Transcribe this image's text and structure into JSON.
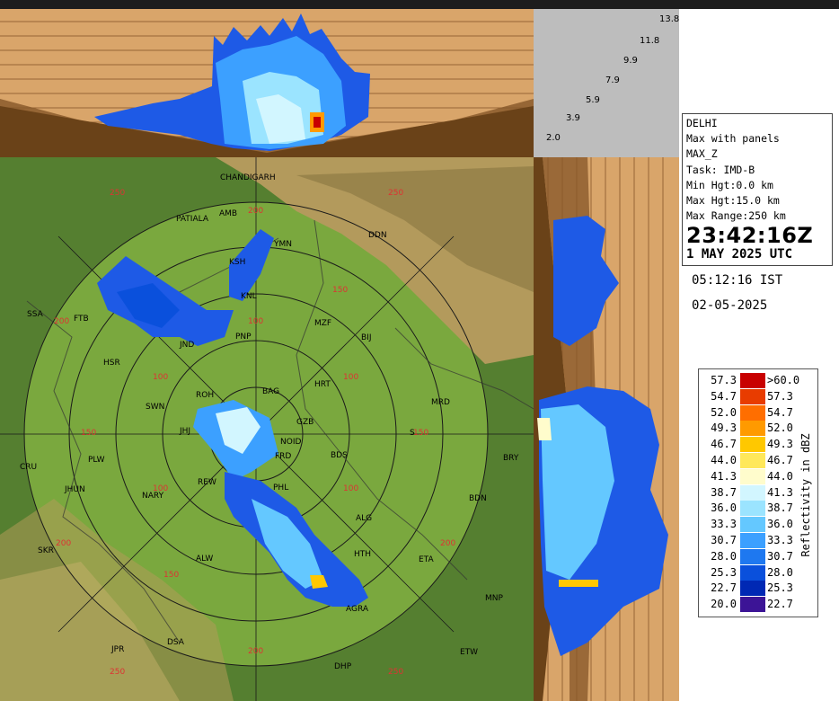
{
  "info": {
    "station": "DELHI",
    "product": "Max with panels",
    "field": "MAX_Z",
    "task": "Task: IMD-B",
    "min_hgt": "Min Hgt:0.0 km",
    "max_hgt": "Max Hgt:15.0 km",
    "max_range": "Max Range:250 km",
    "time_utc": "23:42:16Z",
    "date_utc": "1 MAY 2025 UTC",
    "time_ist": "05:12:16 IST",
    "date_local": "02-05-2025"
  },
  "height_scale": [
    "13.8",
    "11.8",
    "9.9",
    "7.9",
    "5.9",
    "3.9",
    "2.0"
  ],
  "legend": {
    "title": "Reflectivity in dBZ",
    "rows": [
      {
        "low": "57.3",
        "high": ">60.0",
        "color": "#c80000"
      },
      {
        "low": "54.7",
        "high": "57.3",
        "color": "#e83c00"
      },
      {
        "low": "52.0",
        "high": "54.7",
        "color": "#ff6e00"
      },
      {
        "low": "49.3",
        "high": "52.0",
        "color": "#ff9a00"
      },
      {
        "low": "46.7",
        "high": "49.3",
        "color": "#ffc800"
      },
      {
        "low": "44.0",
        "high": "46.7",
        "color": "#ffe85a"
      },
      {
        "low": "41.3",
        "high": "44.0",
        "color": "#fffccc"
      },
      {
        "low": "38.7",
        "high": "41.3",
        "color": "#d2f6ff"
      },
      {
        "low": "36.0",
        "high": "38.7",
        "color": "#9be4ff"
      },
      {
        "low": "33.3",
        "high": "36.0",
        "color": "#64c8ff"
      },
      {
        "low": "30.7",
        "high": "33.3",
        "color": "#3ca0ff"
      },
      {
        "low": "28.0",
        "high": "30.7",
        "color": "#1e78f0"
      },
      {
        "low": "25.3",
        "high": "28.0",
        "color": "#0a50dc"
      },
      {
        "low": "22.7",
        "high": "25.3",
        "color": "#0028b4"
      },
      {
        "low": "20.0",
        "high": "22.7",
        "color": "#3c1496"
      }
    ]
  },
  "range_rings": [
    "50",
    "100",
    "150",
    "200",
    "250"
  ],
  "map_labels": [
    "CHANDIGARH",
    "PATIALA",
    "AMB",
    "DDN",
    "YMN",
    "KSH",
    "KNL",
    "SSA",
    "FTB",
    "JND",
    "PNP",
    "MZF",
    "BIJ",
    "HSR",
    "ROH",
    "BAG",
    "HRT",
    "MRD",
    "SWN",
    "JHJ",
    "GZB",
    "NOID",
    "BDS",
    "S",
    "BRY",
    "CRU",
    "PLW",
    "FRD",
    "JHUN",
    "NARY",
    "REW",
    "PHL",
    "BDN",
    "ALG",
    "SKR",
    "ALW",
    "HTH",
    "ETA",
    "MNP",
    "AGRA",
    "JPR",
    "DSA",
    "ETW",
    "DHP"
  ],
  "colors": {
    "terrain_plain": "#7aa83e",
    "terrain_hills": "#b39a5c",
    "cross_section_bg": "#d9a56a",
    "scale_bg": "#bdbdbd"
  }
}
